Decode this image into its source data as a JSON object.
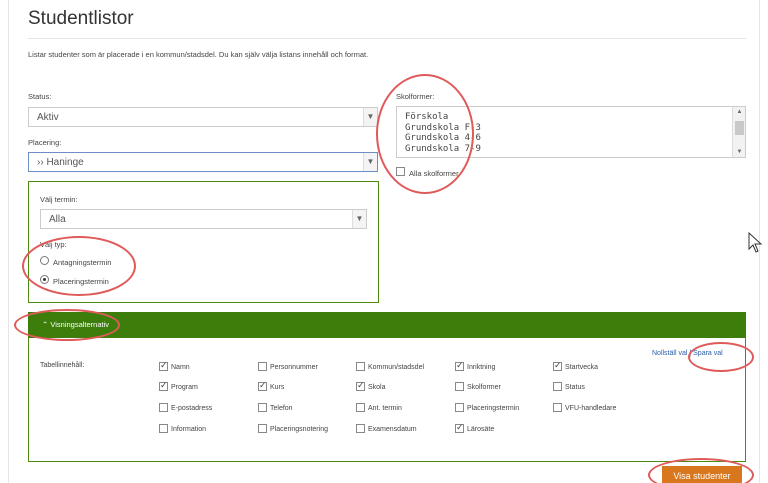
{
  "page": {
    "title": "Studentlistor",
    "intro": "Listar studenter som är placerade i en kommun/stadsdel. Du kan själv välja listans innehåll och format."
  },
  "filters": {
    "status_label": "Status:",
    "status_value": "Aktiv",
    "placering_label": "Placering:",
    "placering_value": "›› Haninge",
    "skolformer_label": "Skolformer:",
    "skolformer_options": [
      "Förskola",
      "Grundskola F-3",
      "Grundskola 4-6",
      "Grundskola 7-9"
    ],
    "alla_skolformer": "Alla skolformer"
  },
  "term": {
    "valj_termin_label": "Välj termin:",
    "termin_value": "Alla",
    "valj_typ_label": "Välj typ:",
    "antagningstermin": "Antagningstermin",
    "placeringstermin": "Placeringstermin"
  },
  "visning": {
    "bar_label": "⌃ Visningsalternativ",
    "tabell_label": "Tabellinnehåll:",
    "reset_link": "Nollställ val",
    "separator": "|",
    "save_link": "Spara val",
    "checkboxes": [
      {
        "label": "Namn",
        "checked": true
      },
      {
        "label": "Personnummer",
        "checked": false
      },
      {
        "label": "Kommun/stadsdel",
        "checked": false
      },
      {
        "label": "Inriktning",
        "checked": true
      },
      {
        "label": "Startvecka",
        "checked": true
      },
      {
        "label": "Program",
        "checked": true
      },
      {
        "label": "Kurs",
        "checked": true
      },
      {
        "label": "Skola",
        "checked": true
      },
      {
        "label": "Skolformer",
        "checked": false
      },
      {
        "label": "Status",
        "checked": false
      },
      {
        "label": "E-postadress",
        "checked": false
      },
      {
        "label": "Telefon",
        "checked": false
      },
      {
        "label": "Ant. termin",
        "checked": false
      },
      {
        "label": "Placeringstermin",
        "checked": false
      },
      {
        "label": "VFU-handledare",
        "checked": false
      },
      {
        "label": "Information",
        "checked": false
      },
      {
        "label": "Placeringsnotering",
        "checked": false
      },
      {
        "label": "Examensdatum",
        "checked": false
      },
      {
        "label": "Lärosäte",
        "checked": true
      }
    ]
  },
  "actions": {
    "visa_label": "Visa studenter"
  },
  "colors": {
    "accent_green": "#3d7d0b",
    "button_orange": "#d9771e",
    "annotation_red": "#e05a5a"
  }
}
